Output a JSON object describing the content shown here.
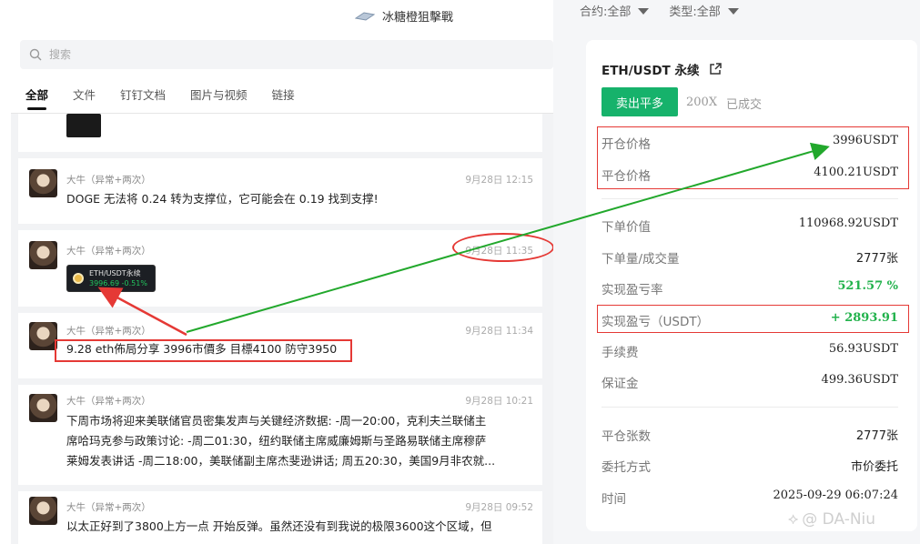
{
  "chat": {
    "title": "冰糖橙狙擊戰",
    "search_placeholder": "搜索",
    "tabs": [
      {
        "label": "全部",
        "active": true
      },
      {
        "label": "文件"
      },
      {
        "label": "钉钉文档"
      },
      {
        "label": "图片与视频"
      },
      {
        "label": "链接"
      }
    ],
    "messages": [
      {
        "sender": "大牛（异常+两次）",
        "time": "9月28日 12:15",
        "text": "DOGE 无法将 0.24 转为支撑位，它可能会在 0.19 找到支撑!"
      },
      {
        "sender": "大牛（异常+两次）",
        "time": "9月28日 11:35",
        "sticker_name": "ETH/USDT永续",
        "sticker_price": "3996.69 -0.51%"
      },
      {
        "sender": "大牛（异常+两次）",
        "time": "9月28日 11:34",
        "text": "9.28 eth佈局分享 3996市價多 目標4100 防守3950"
      },
      {
        "sender": "大牛（异常+两次）",
        "time": "9月28日 10:21",
        "lines": [
          "下周市场将迎来美联储官员密集发声与关键经济数据: -周一20:00，克利夫兰联储主",
          "席哈玛克参与政策讨论: -周二01:30，纽约联储主席威廉姆斯与圣路易联储主席穆萨",
          "莱姆发表讲话 -周二18:00，美联储副主席杰斐逊讲话; 周五20:30，美国9月非农就..."
        ]
      },
      {
        "sender": "大牛（异常+两次）",
        "time": "9月28日 09:52",
        "text": "以太正好到了3800上方一点 开始反弹。虽然还没有到我说的极限3600这个区域，但"
      }
    ]
  },
  "filters": {
    "contract": "合约:全部",
    "type": "类型:全部"
  },
  "order": {
    "pair": "ETH/USDT 永续",
    "side": "卖出平多",
    "leverage": "200X",
    "status": "已成交",
    "rows": [
      {
        "label": "开仓价格",
        "value": "3996USDT"
      },
      {
        "label": "平仓价格",
        "value": "4100.21USDT"
      },
      {
        "label": "下单价值",
        "value": "110968.92USDT"
      },
      {
        "label": "下单量/成交量",
        "value": "2777张"
      },
      {
        "label": "实现盈亏率",
        "value": "521.57 %"
      },
      {
        "label": "实现盈亏（USDT）",
        "value": "+ 2893.91"
      },
      {
        "label": "手续费",
        "value": "56.93USDT"
      },
      {
        "label": "保证金",
        "value": "499.36USDT"
      },
      {
        "label": "平仓张数",
        "value": "2777张"
      },
      {
        "label": "委托方式",
        "value": "市价委托"
      },
      {
        "label": "时间",
        "value": "2025-09-29 06:07:24"
      }
    ]
  },
  "colors": {
    "buy_green": "#16b26b",
    "profit_green": "#22b24c",
    "annotation_red": "#e53935",
    "arrow_green": "#22a82c"
  },
  "watermark": "@ DA-Niu"
}
